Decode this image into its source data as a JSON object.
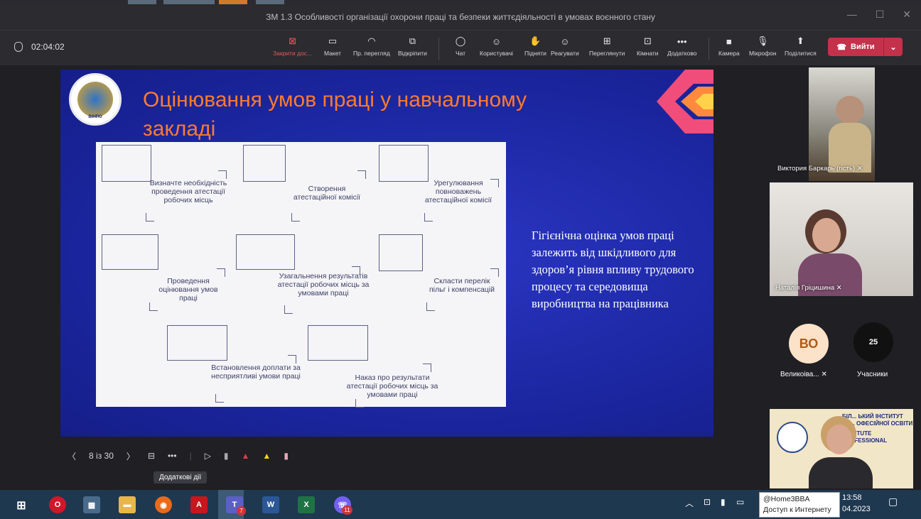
{
  "window": {
    "title": "ЗМ 1.3 Особливості організації охорони праці та безпеки життєдіяльності в умовах воєнного стану"
  },
  "toolbar": {
    "timer": "02:04:02",
    "buttons": [
      {
        "label": "Закрити дос...",
        "icon": "close-share-icon"
      },
      {
        "label": "Макет",
        "icon": "layout-icon"
      },
      {
        "label": "Пр. перегляд",
        "icon": "eye-icon"
      },
      {
        "label": "Відкріпити",
        "icon": "popout-icon"
      },
      {
        "label": "Чат",
        "icon": "chat-icon"
      },
      {
        "label": "Користувачі",
        "icon": "people-icon"
      },
      {
        "label": "Підняти",
        "icon": "hand-icon"
      },
      {
        "label": "Реагувати",
        "icon": "smile-icon"
      },
      {
        "label": "Переглянути",
        "icon": "grid-icon"
      },
      {
        "label": "Кімнати",
        "icon": "rooms-icon"
      },
      {
        "label": "Додатково",
        "icon": "more-icon"
      },
      {
        "label": "Камера",
        "icon": "camera-icon"
      },
      {
        "label": "Мікрофон",
        "icon": "mic-icon"
      },
      {
        "label": "Поділитися",
        "icon": "share-icon"
      }
    ],
    "leave_label": "Вийти"
  },
  "slide": {
    "title": "Оцінювання умов праці у навчальному закладі",
    "logo_text": "ВІНПО",
    "steps": [
      "Визначте необхідність проведення атестації робочих місць",
      "Створення атестаційної комісії",
      "Урегулювання повноважень атестаційної комісії",
      "Проведення оцінювання умов праці",
      "Узагальнення результатів атестації робочих місць за умовами праці",
      "Скласти перелік пільг і компенсацій",
      "Встановлення доплати за несприятливі умови праці",
      "Наказ про результати атестації робочих місць за умовами праці"
    ],
    "body": "Гігієнічна оцінка умов праці залежить від шкідливого для здоров’я рівня впливу трудового процесу та середовища виробництва на працівника"
  },
  "slide_nav": {
    "counter": "8 із 30",
    "tooltip": "Додаткові дії"
  },
  "participants": {
    "tile1_name": "Виктория Баркарь (гість)",
    "tile2_name": "Наталія Гріцишина",
    "avatar_initials": "ВО",
    "avatar_name": "Великоіва...",
    "count": "25",
    "count_label": "Учасники",
    "presenter_banner_line1": "БІЛ... ЬКИЙ ІНСТИТУТ",
    "presenter_banner_line2": "НЕ... ОФЕСІЙНОЇ ОСВІТИ",
    "presenter_banner_line3": "INSTITUTE",
    "presenter_banner_line4": "PROFESSIONAL"
  },
  "taskbar": {
    "network_popup_line1": "@Home3BBA",
    "network_popup_line2": "Доступ к Интернету",
    "time": "13:58",
    "date": "04.2023",
    "teams_badge": "7",
    "viber_badge": "11"
  },
  "colors": {
    "slide_blue": "#1e2aa8",
    "title_orange": "#ff7a2e",
    "leave_red": "#c4314b"
  }
}
